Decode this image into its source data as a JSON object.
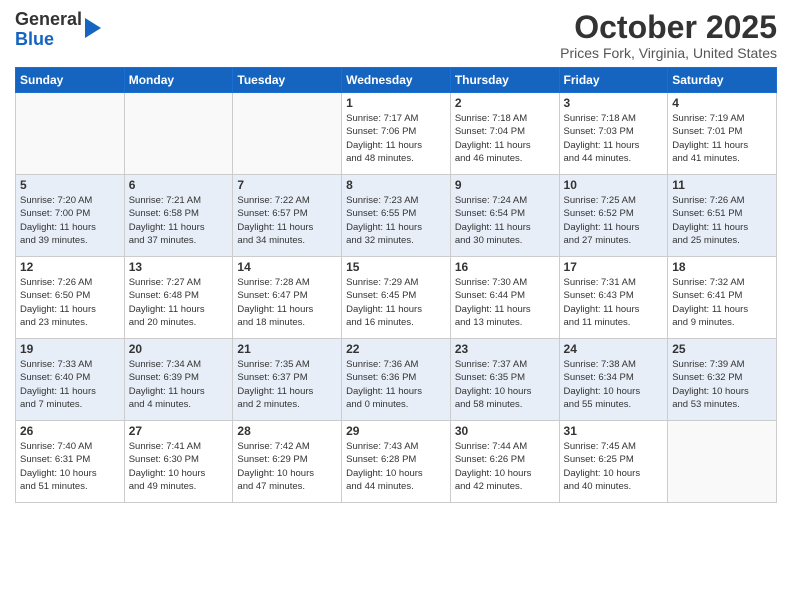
{
  "header": {
    "logo_line1": "General",
    "logo_line2": "Blue",
    "month": "October 2025",
    "location": "Prices Fork, Virginia, United States"
  },
  "weekdays": [
    "Sunday",
    "Monday",
    "Tuesday",
    "Wednesday",
    "Thursday",
    "Friday",
    "Saturday"
  ],
  "weeks": [
    [
      {
        "day": "",
        "info": ""
      },
      {
        "day": "",
        "info": ""
      },
      {
        "day": "",
        "info": ""
      },
      {
        "day": "1",
        "info": "Sunrise: 7:17 AM\nSunset: 7:06 PM\nDaylight: 11 hours\nand 48 minutes."
      },
      {
        "day": "2",
        "info": "Sunrise: 7:18 AM\nSunset: 7:04 PM\nDaylight: 11 hours\nand 46 minutes."
      },
      {
        "day": "3",
        "info": "Sunrise: 7:18 AM\nSunset: 7:03 PM\nDaylight: 11 hours\nand 44 minutes."
      },
      {
        "day": "4",
        "info": "Sunrise: 7:19 AM\nSunset: 7:01 PM\nDaylight: 11 hours\nand 41 minutes."
      }
    ],
    [
      {
        "day": "5",
        "info": "Sunrise: 7:20 AM\nSunset: 7:00 PM\nDaylight: 11 hours\nand 39 minutes."
      },
      {
        "day": "6",
        "info": "Sunrise: 7:21 AM\nSunset: 6:58 PM\nDaylight: 11 hours\nand 37 minutes."
      },
      {
        "day": "7",
        "info": "Sunrise: 7:22 AM\nSunset: 6:57 PM\nDaylight: 11 hours\nand 34 minutes."
      },
      {
        "day": "8",
        "info": "Sunrise: 7:23 AM\nSunset: 6:55 PM\nDaylight: 11 hours\nand 32 minutes."
      },
      {
        "day": "9",
        "info": "Sunrise: 7:24 AM\nSunset: 6:54 PM\nDaylight: 11 hours\nand 30 minutes."
      },
      {
        "day": "10",
        "info": "Sunrise: 7:25 AM\nSunset: 6:52 PM\nDaylight: 11 hours\nand 27 minutes."
      },
      {
        "day": "11",
        "info": "Sunrise: 7:26 AM\nSunset: 6:51 PM\nDaylight: 11 hours\nand 25 minutes."
      }
    ],
    [
      {
        "day": "12",
        "info": "Sunrise: 7:26 AM\nSunset: 6:50 PM\nDaylight: 11 hours\nand 23 minutes."
      },
      {
        "day": "13",
        "info": "Sunrise: 7:27 AM\nSunset: 6:48 PM\nDaylight: 11 hours\nand 20 minutes."
      },
      {
        "day": "14",
        "info": "Sunrise: 7:28 AM\nSunset: 6:47 PM\nDaylight: 11 hours\nand 18 minutes."
      },
      {
        "day": "15",
        "info": "Sunrise: 7:29 AM\nSunset: 6:45 PM\nDaylight: 11 hours\nand 16 minutes."
      },
      {
        "day": "16",
        "info": "Sunrise: 7:30 AM\nSunset: 6:44 PM\nDaylight: 11 hours\nand 13 minutes."
      },
      {
        "day": "17",
        "info": "Sunrise: 7:31 AM\nSunset: 6:43 PM\nDaylight: 11 hours\nand 11 minutes."
      },
      {
        "day": "18",
        "info": "Sunrise: 7:32 AM\nSunset: 6:41 PM\nDaylight: 11 hours\nand 9 minutes."
      }
    ],
    [
      {
        "day": "19",
        "info": "Sunrise: 7:33 AM\nSunset: 6:40 PM\nDaylight: 11 hours\nand 7 minutes."
      },
      {
        "day": "20",
        "info": "Sunrise: 7:34 AM\nSunset: 6:39 PM\nDaylight: 11 hours\nand 4 minutes."
      },
      {
        "day": "21",
        "info": "Sunrise: 7:35 AM\nSunset: 6:37 PM\nDaylight: 11 hours\nand 2 minutes."
      },
      {
        "day": "22",
        "info": "Sunrise: 7:36 AM\nSunset: 6:36 PM\nDaylight: 11 hours\nand 0 minutes."
      },
      {
        "day": "23",
        "info": "Sunrise: 7:37 AM\nSunset: 6:35 PM\nDaylight: 10 hours\nand 58 minutes."
      },
      {
        "day": "24",
        "info": "Sunrise: 7:38 AM\nSunset: 6:34 PM\nDaylight: 10 hours\nand 55 minutes."
      },
      {
        "day": "25",
        "info": "Sunrise: 7:39 AM\nSunset: 6:32 PM\nDaylight: 10 hours\nand 53 minutes."
      }
    ],
    [
      {
        "day": "26",
        "info": "Sunrise: 7:40 AM\nSunset: 6:31 PM\nDaylight: 10 hours\nand 51 minutes."
      },
      {
        "day": "27",
        "info": "Sunrise: 7:41 AM\nSunset: 6:30 PM\nDaylight: 10 hours\nand 49 minutes."
      },
      {
        "day": "28",
        "info": "Sunrise: 7:42 AM\nSunset: 6:29 PM\nDaylight: 10 hours\nand 47 minutes."
      },
      {
        "day": "29",
        "info": "Sunrise: 7:43 AM\nSunset: 6:28 PM\nDaylight: 10 hours\nand 44 minutes."
      },
      {
        "day": "30",
        "info": "Sunrise: 7:44 AM\nSunset: 6:26 PM\nDaylight: 10 hours\nand 42 minutes."
      },
      {
        "day": "31",
        "info": "Sunrise: 7:45 AM\nSunset: 6:25 PM\nDaylight: 10 hours\nand 40 minutes."
      },
      {
        "day": "",
        "info": ""
      }
    ]
  ]
}
